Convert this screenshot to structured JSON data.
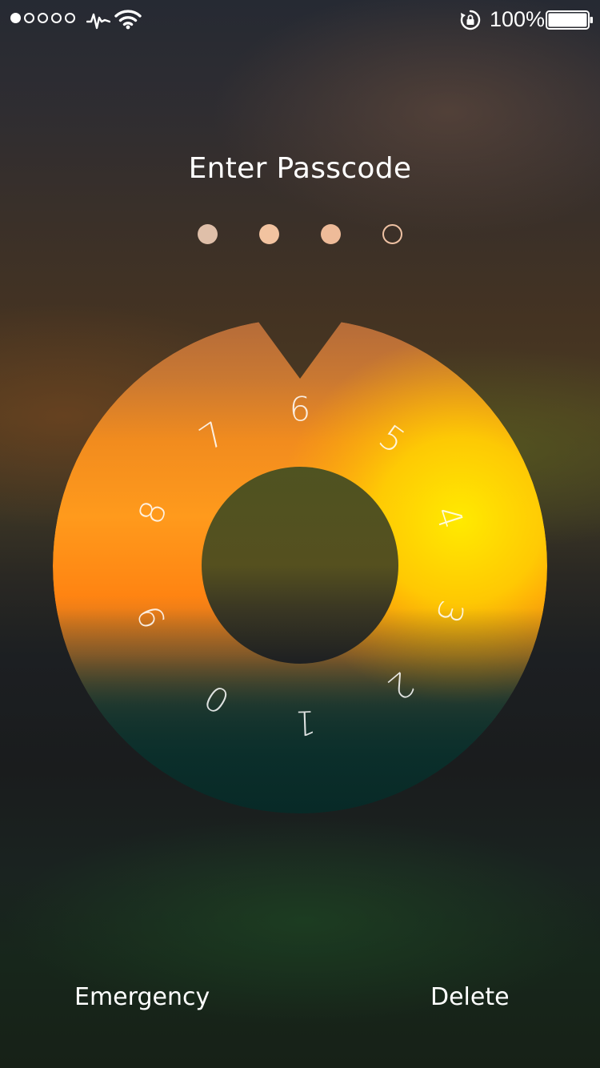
{
  "status_bar": {
    "signal_strength": 1,
    "signal_max": 5,
    "activity_icon": "activity-pulse-icon",
    "wifi_icon": "wifi-icon",
    "rotation_lock_icon": "rotation-lock-icon",
    "battery_text": "100%",
    "battery_level": 1.0
  },
  "lock_screen": {
    "title": "Enter Passcode",
    "passcode_length": 4,
    "entered_count": 3,
    "dot_colors": [
      "#dfbfa9",
      "#f2c3a0",
      "#eebb99",
      "#eec1a3"
    ]
  },
  "dial": {
    "digits": [
      "0",
      "1",
      "2",
      "3",
      "4",
      "5",
      "6",
      "7",
      "8",
      "9"
    ],
    "colors": {
      "top": "#b46b3a",
      "orange": "#ff9a1c",
      "deep_orange": "#ff8412",
      "yellow": "#ffea00",
      "bottom_fade": "#0b2e2a",
      "hub": "#4f5321"
    }
  },
  "bottom": {
    "emergency_label": "Emergency",
    "delete_label": "Delete"
  }
}
